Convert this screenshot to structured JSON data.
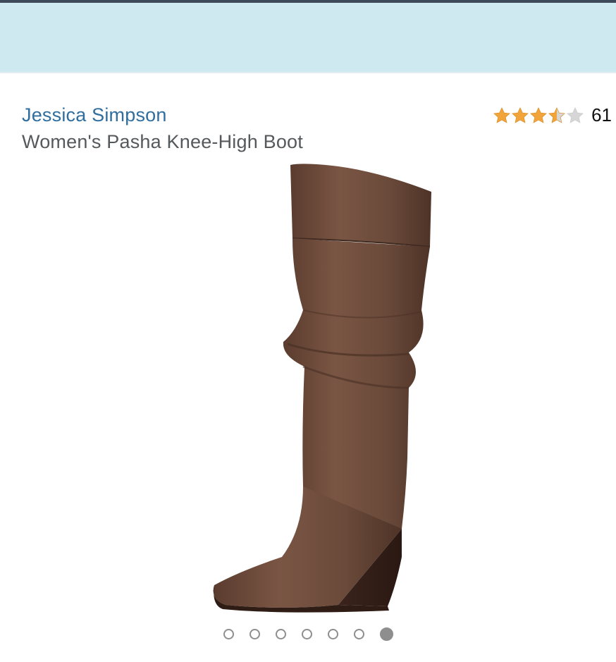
{
  "header": {
    "background_color": "#cfe9f0"
  },
  "product": {
    "brand": "Jessica Simpson",
    "title": "Women's Pasha Knee-High Boot",
    "rating": {
      "stars": 3.5,
      "max_stars": 5,
      "count": "61"
    },
    "image": {
      "subject": "brown leather knee-high wedge boot",
      "color": "#6b4a3a"
    },
    "gallery": {
      "total_images": 7,
      "active_index": 6
    }
  },
  "colors": {
    "brand_link": "#2f6e9e",
    "star_filled": "#f0a43a",
    "star_empty": "#d6d6d6"
  },
  "icons": {
    "star": "star-icon"
  }
}
